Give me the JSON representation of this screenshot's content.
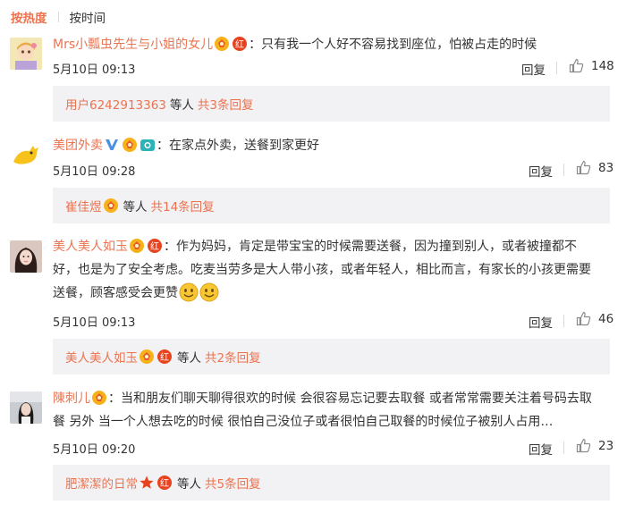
{
  "sort": {
    "hot": "按热度",
    "time": "按时间"
  },
  "comments": [
    {
      "username": "Mrs小瓢虫先生与小姐的女儿",
      "text": "只有我一个人好不容易找到座位，怕被占走的时候",
      "time": "5月10日 09:13",
      "reply_label": "回复",
      "likes": "148",
      "reply_box": {
        "users": "用户6242913363",
        "suffix": "等人",
        "link": "共3条回复"
      }
    },
    {
      "username": "美团外卖",
      "text": "在家点外卖，送餐到家更好",
      "time": "5月10日 09:28",
      "reply_label": "回复",
      "likes": "83",
      "reply_box": {
        "users": "崔佳煜",
        "suffix": "等人",
        "link": "共14条回复"
      }
    },
    {
      "username": "美人美人如玉",
      "text_line1": "作为妈妈，肯定是带宝宝的时候需要送餐，因为撞到别人，或者被撞都不",
      "text_line2": "好，也是为了安全考虑。吃麦当劳多是大人带小孩，或者年轻人，相比而言，有家长的小孩更需要",
      "text_line3": "送餐，顾客感受会更赞",
      "time": "5月10日 09:13",
      "reply_label": "回复",
      "likes": "46",
      "reply_box": {
        "users": "美人美人如玉",
        "suffix": "等人",
        "link": "共2条回复"
      }
    },
    {
      "username": "陳刺儿",
      "text_line1": "当和朋友们聊天聊得很欢的时候 会很容易忘记要去取餐 或者常常需要关注着号码去取",
      "text_line2": "餐 另外 当一个人想去吃的时候 很怕自己没位子或者很怕自己取餐的时候位子被别人占用…",
      "time": "5月10日 09:20",
      "reply_label": "回复",
      "likes": "23",
      "reply_box": {
        "users": "肥潔潔的日常",
        "suffix": "等人",
        "link": "共5条回复"
      }
    }
  ],
  "colors": {
    "accent": "#eb7350",
    "reply_bg": "#f2f2f5",
    "verified": "#4a90e2"
  }
}
